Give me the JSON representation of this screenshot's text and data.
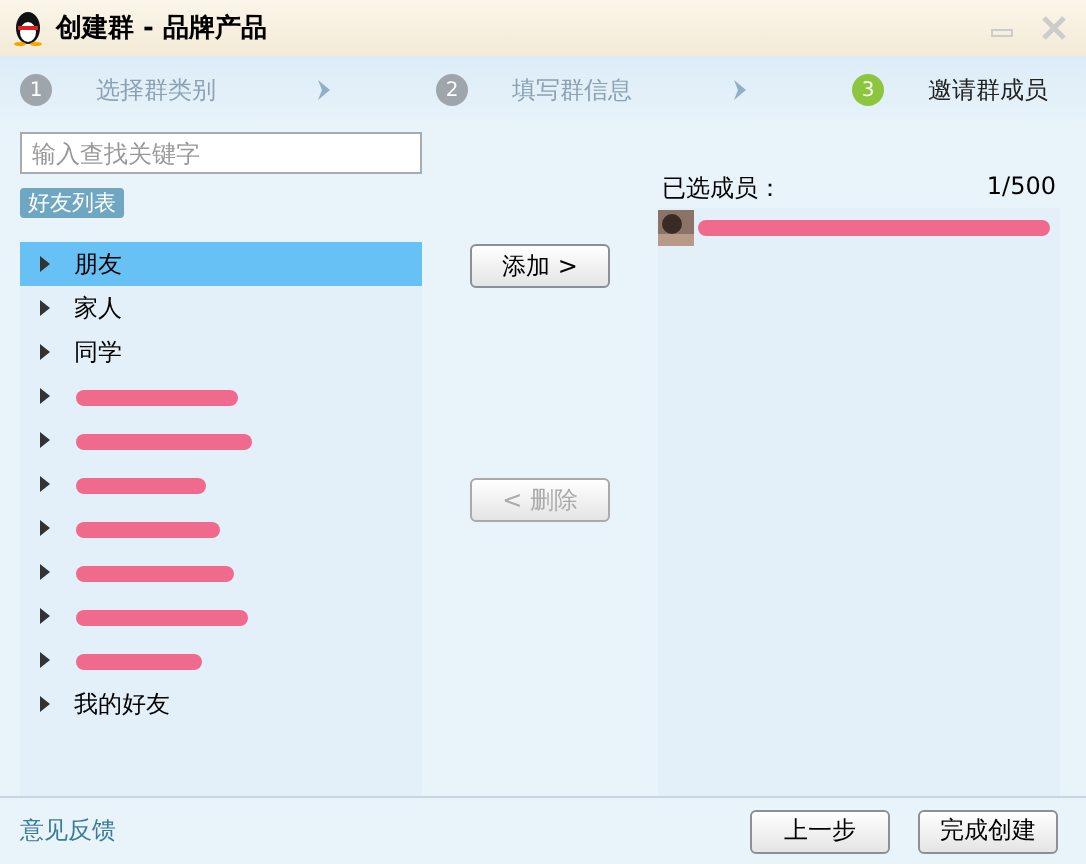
{
  "window": {
    "title": "创建群 - 品牌产品"
  },
  "steps": [
    {
      "number": "1",
      "label": "选择群类别",
      "selected": false
    },
    {
      "number": "2",
      "label": "填写群信息",
      "selected": false
    },
    {
      "number": "3",
      "label": "邀请群成员",
      "selected": true
    }
  ],
  "search": {
    "placeholder": "输入查找关键字"
  },
  "list_tab": "好友列表",
  "groups": [
    {
      "label": "朋友",
      "selected": true,
      "redacted": false
    },
    {
      "label": "家人",
      "selected": false,
      "redacted": false
    },
    {
      "label": "同学",
      "selected": false,
      "redacted": false
    },
    {
      "selected": false,
      "redacted": true
    },
    {
      "selected": false,
      "redacted": true
    },
    {
      "selected": false,
      "redacted": true
    },
    {
      "selected": false,
      "redacted": true
    },
    {
      "selected": false,
      "redacted": true
    },
    {
      "selected": false,
      "redacted": true
    },
    {
      "selected": false,
      "redacted": true
    },
    {
      "label": "我的好友",
      "selected": false,
      "redacted": false
    }
  ],
  "add_button": {
    "label": "添加 >",
    "disabled": false
  },
  "remove_button": {
    "label": "< 删除",
    "disabled": true
  },
  "selected_members": {
    "title": "已选成员：",
    "count": "1/500",
    "members": [
      {
        "kind": "picture",
        "redacted": true
      }
    ]
  },
  "feedback_link": "意见反馈",
  "buttons": [
    "上一步",
    "完成创建"
  ]
}
